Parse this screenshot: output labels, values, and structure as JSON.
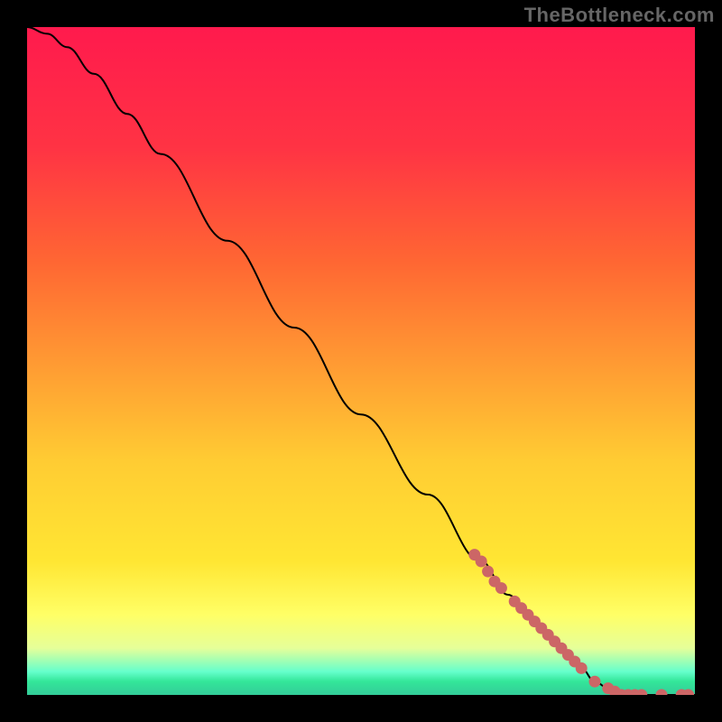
{
  "watermark": "TheBottleneck.com",
  "colors": {
    "frame": "#000000",
    "curve": "#000000",
    "dots": "#cc6666",
    "gradient_stops": [
      {
        "offset": 0.0,
        "color": "#ff1a4d"
      },
      {
        "offset": 0.18,
        "color": "#ff3344"
      },
      {
        "offset": 0.35,
        "color": "#ff6633"
      },
      {
        "offset": 0.5,
        "color": "#ff9933"
      },
      {
        "offset": 0.65,
        "color": "#ffcc33"
      },
      {
        "offset": 0.8,
        "color": "#ffe633"
      },
      {
        "offset": 0.88,
        "color": "#ffff66"
      },
      {
        "offset": 0.93,
        "color": "#e6ff99"
      },
      {
        "offset": 0.965,
        "color": "#66ffcc"
      },
      {
        "offset": 0.98,
        "color": "#33e699"
      },
      {
        "offset": 1.0,
        "color": "#33cc99"
      }
    ]
  },
  "chart_data": {
    "type": "line",
    "title": "",
    "xlabel": "",
    "ylabel": "",
    "xlim": [
      0,
      100
    ],
    "ylim": [
      0,
      100
    ],
    "series": [
      {
        "name": "curve",
        "x": [
          0,
          3,
          6,
          10,
          15,
          20,
          30,
          40,
          50,
          60,
          68,
          72,
          76,
          80,
          83,
          85,
          87,
          90,
          93,
          95,
          100
        ],
        "y": [
          100,
          99,
          97,
          93,
          87,
          81,
          68,
          55,
          42,
          30,
          20,
          15,
          11,
          7,
          4,
          2,
          1,
          0,
          0,
          0,
          0
        ]
      }
    ],
    "dots": [
      {
        "x": 67,
        "y": 21
      },
      {
        "x": 68,
        "y": 20
      },
      {
        "x": 69,
        "y": 18.5
      },
      {
        "x": 70,
        "y": 17
      },
      {
        "x": 71,
        "y": 16
      },
      {
        "x": 73,
        "y": 14
      },
      {
        "x": 74,
        "y": 13
      },
      {
        "x": 75,
        "y": 12
      },
      {
        "x": 76,
        "y": 11
      },
      {
        "x": 77,
        "y": 10
      },
      {
        "x": 78,
        "y": 9
      },
      {
        "x": 79,
        "y": 8
      },
      {
        "x": 80,
        "y": 7
      },
      {
        "x": 81,
        "y": 6
      },
      {
        "x": 82,
        "y": 5
      },
      {
        "x": 83,
        "y": 4
      },
      {
        "x": 85,
        "y": 2
      },
      {
        "x": 87,
        "y": 1
      },
      {
        "x": 88,
        "y": 0.5
      },
      {
        "x": 89,
        "y": 0
      },
      {
        "x": 90,
        "y": 0
      },
      {
        "x": 91,
        "y": 0
      },
      {
        "x": 92,
        "y": 0
      },
      {
        "x": 95,
        "y": 0
      },
      {
        "x": 98,
        "y": 0
      },
      {
        "x": 99,
        "y": 0
      }
    ]
  }
}
